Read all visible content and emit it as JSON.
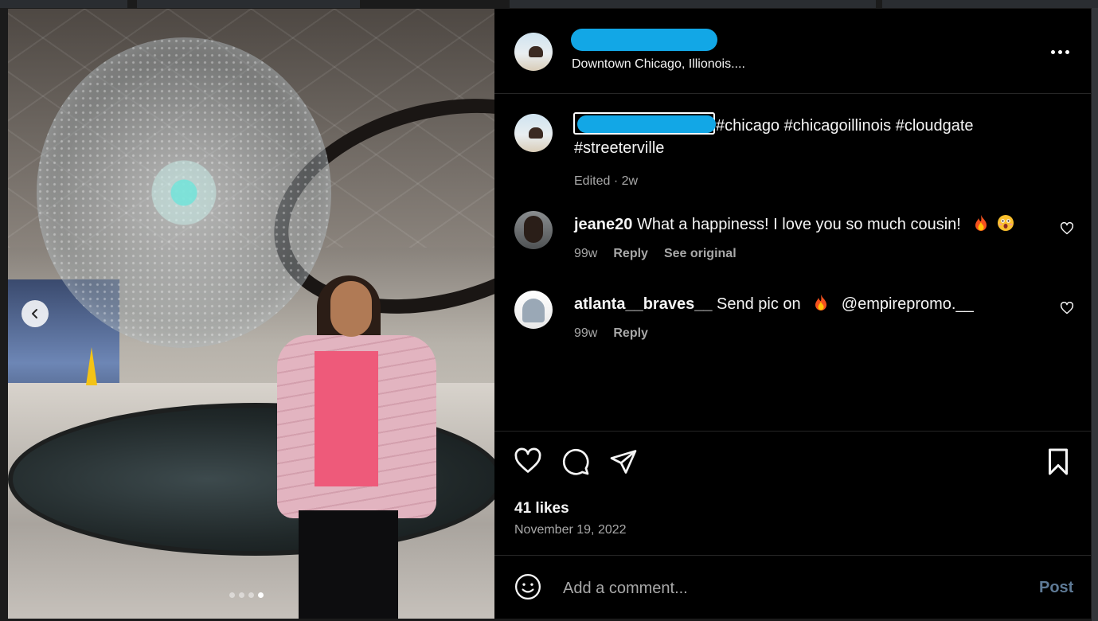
{
  "post": {
    "location": "Downtown Chicago, Illionois....",
    "caption_hashtags": "#chicago #chicagoillinois #cloudgate #streeterville",
    "caption_meta": "Edited · 2w"
  },
  "carousel": {
    "slide_count": 4,
    "active_slide": 4
  },
  "comments": [
    {
      "username": "jeane20",
      "text": "What a happiness! I love you so much cousin!",
      "age": "99w",
      "reply_label": "Reply",
      "see_original_label": "See original",
      "emojis": [
        "fire-emoji",
        "astonished-face-emoji"
      ]
    },
    {
      "username": "atlanta__braves__",
      "text_before": "Send pic on",
      "text_after": "@empirepromo.__",
      "age": "99w",
      "reply_label": "Reply",
      "emojis": [
        "fire-emoji"
      ]
    }
  ],
  "engagement": {
    "likes": "41 likes",
    "date": "November 19, 2022"
  },
  "composer": {
    "placeholder": "Add a comment...",
    "post_label": "Post"
  },
  "colors": {
    "background": "#000000",
    "redaction": "#12a7e6",
    "muted_text": "#a8a8a8",
    "post_button": "#5e7a96"
  },
  "icons": [
    "chevron-left-icon",
    "more-icon",
    "heart-icon",
    "comment-icon",
    "share-icon",
    "bookmark-icon",
    "emoji-icon"
  ]
}
